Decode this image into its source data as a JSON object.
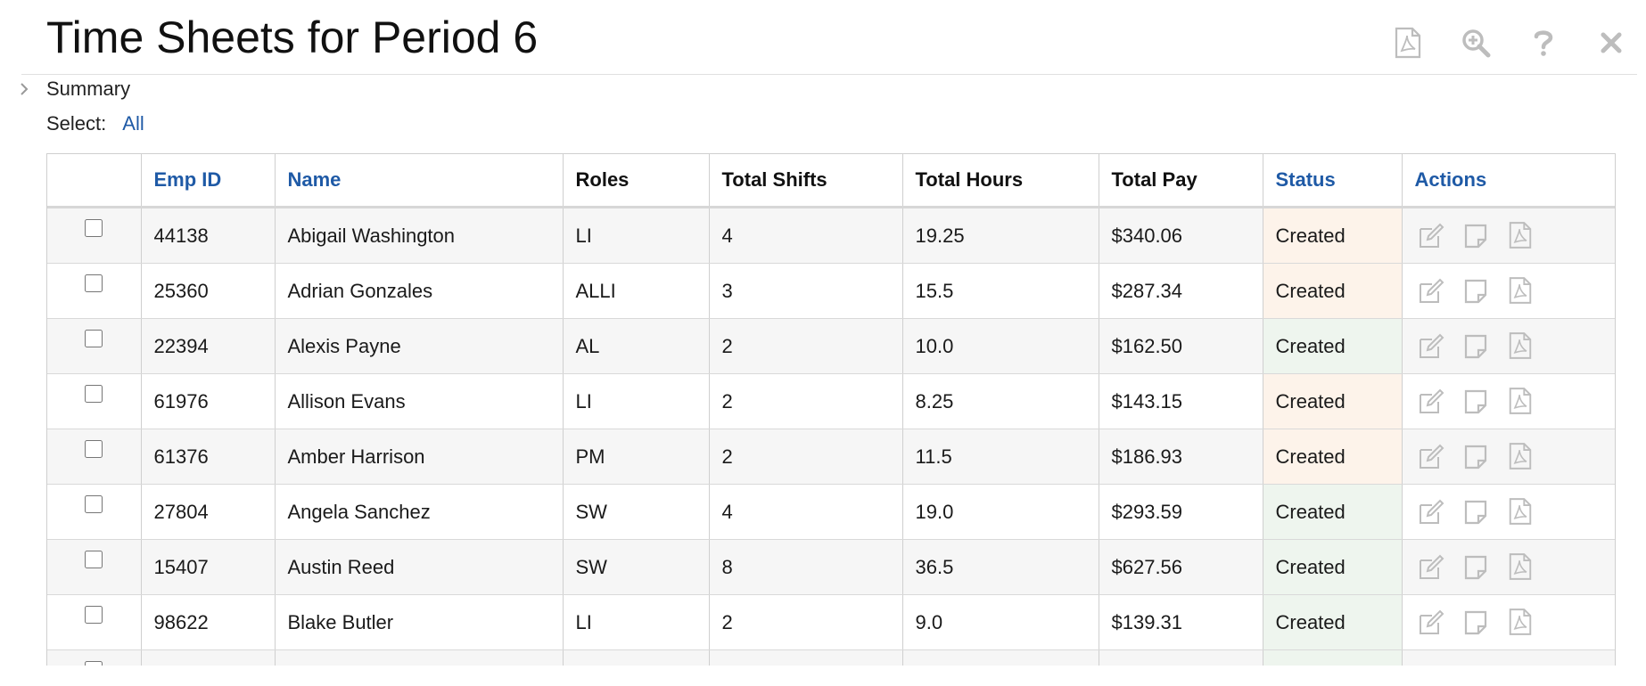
{
  "title": "Time Sheets for Period 6",
  "toolbar": {
    "icons": [
      "pdf-icon",
      "zoom-in-icon",
      "help-icon",
      "close-icon"
    ]
  },
  "summary": {
    "label": "Summary"
  },
  "select": {
    "label": "Select:",
    "all_link": "All"
  },
  "table": {
    "headers": {
      "emp_id": "Emp ID",
      "name": "Name",
      "roles": "Roles",
      "total_shifts": "Total Shifts",
      "total_hours": "Total Hours",
      "total_pay": "Total Pay",
      "status": "Status",
      "actions": "Actions"
    },
    "rows": [
      {
        "emp_id": "44138",
        "name": "Abigail Washington",
        "roles": "LI",
        "shifts": "4",
        "hours": "19.25",
        "pay": "$340.06",
        "status": "Created"
      },
      {
        "emp_id": "25360",
        "name": "Adrian Gonzales",
        "roles": "ALLI",
        "shifts": "3",
        "hours": "15.5",
        "pay": "$287.34",
        "status": "Created"
      },
      {
        "emp_id": "22394",
        "name": "Alexis Payne",
        "roles": "AL",
        "shifts": "2",
        "hours": "10.0",
        "pay": "$162.50",
        "status": "Created"
      },
      {
        "emp_id": "61976",
        "name": "Allison Evans",
        "roles": "LI",
        "shifts": "2",
        "hours": "8.25",
        "pay": "$143.15",
        "status": "Created"
      },
      {
        "emp_id": "61376",
        "name": "Amber Harrison",
        "roles": "PM",
        "shifts": "2",
        "hours": "11.5",
        "pay": "$186.93",
        "status": "Created"
      },
      {
        "emp_id": "27804",
        "name": "Angela Sanchez",
        "roles": "SW",
        "shifts": "4",
        "hours": "19.0",
        "pay": "$293.59",
        "status": "Created"
      },
      {
        "emp_id": "15407",
        "name": "Austin Reed",
        "roles": "SW",
        "shifts": "8",
        "hours": "36.5",
        "pay": "$627.56",
        "status": "Created"
      },
      {
        "emp_id": "98622",
        "name": "Blake Butler",
        "roles": "LI",
        "shifts": "2",
        "hours": "9.0",
        "pay": "$139.31",
        "status": "Created"
      }
    ],
    "status_tints": [
      "#fdf3ea",
      "#fdf3ea",
      "#eef5ee",
      "#fdf3ea",
      "#fdf3ea",
      "#eef5ee",
      "#eef5ee",
      "#eef5ee"
    ],
    "row_action_icons": [
      "edit-icon",
      "note-icon",
      "pdf-icon"
    ]
  },
  "colors": {
    "link": "#1f5aa6",
    "icon_gray": "#bdbdbd",
    "row_alt": "#f6f6f6"
  }
}
